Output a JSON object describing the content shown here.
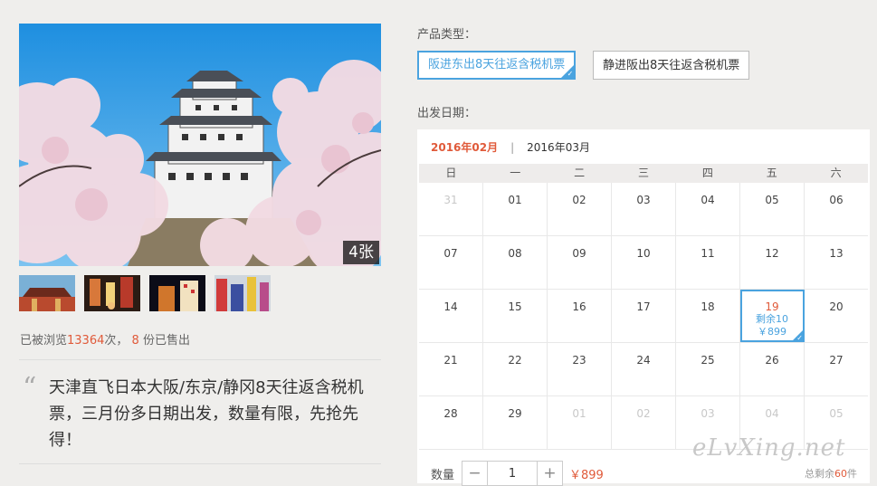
{
  "gallery": {
    "photo_count": "4张",
    "thumbnails": [
      "temple-thumb",
      "street-thumb",
      "night-thumb",
      "city-thumb"
    ]
  },
  "stats": {
    "views_prefix": "已被浏览",
    "views": "13364",
    "views_suffix": "次，",
    "sold": "8",
    "sold_suffix": "份已售出"
  },
  "description": "天津直飞日本大阪/东京/静冈8天往返含税机票，三月份多日期出发，数量有限，先抢先得！",
  "product_type": {
    "label": "产品类型：",
    "options": [
      {
        "label": "阪进东出8天往返含税机票",
        "selected": true
      },
      {
        "label": "静进阪出8天往返含税机票",
        "selected": false
      }
    ]
  },
  "departure": {
    "label": "出发日期："
  },
  "calendar": {
    "months": [
      "2016年02月",
      "2016年03月"
    ],
    "active_month": "2016年02月",
    "weekdays": [
      "日",
      "一",
      "二",
      "三",
      "四",
      "五",
      "六"
    ],
    "weeks": [
      [
        "31",
        "01",
        "02",
        "03",
        "04",
        "05",
        "06"
      ],
      [
        "07",
        "08",
        "09",
        "10",
        "11",
        "12",
        "13"
      ],
      [
        "14",
        "15",
        "16",
        "17",
        "18",
        "19",
        "20"
      ],
      [
        "21",
        "22",
        "23",
        "24",
        "25",
        "26",
        "27"
      ],
      [
        "28",
        "29",
        "01",
        "02",
        "03",
        "04",
        "05"
      ]
    ],
    "selected": {
      "day": "19",
      "remain": "剩余10",
      "price": "￥899"
    }
  },
  "quantity": {
    "label": "数量",
    "value": "1",
    "minus": "−",
    "plus": "+",
    "price": "￥899"
  },
  "total_remain": {
    "prefix": "总剩余",
    "count": "60",
    "suffix": "件"
  },
  "watermark": "eLvXing.net",
  "colors": {
    "accent": "#e05a3a",
    "select_blue": "#4aa3df"
  }
}
